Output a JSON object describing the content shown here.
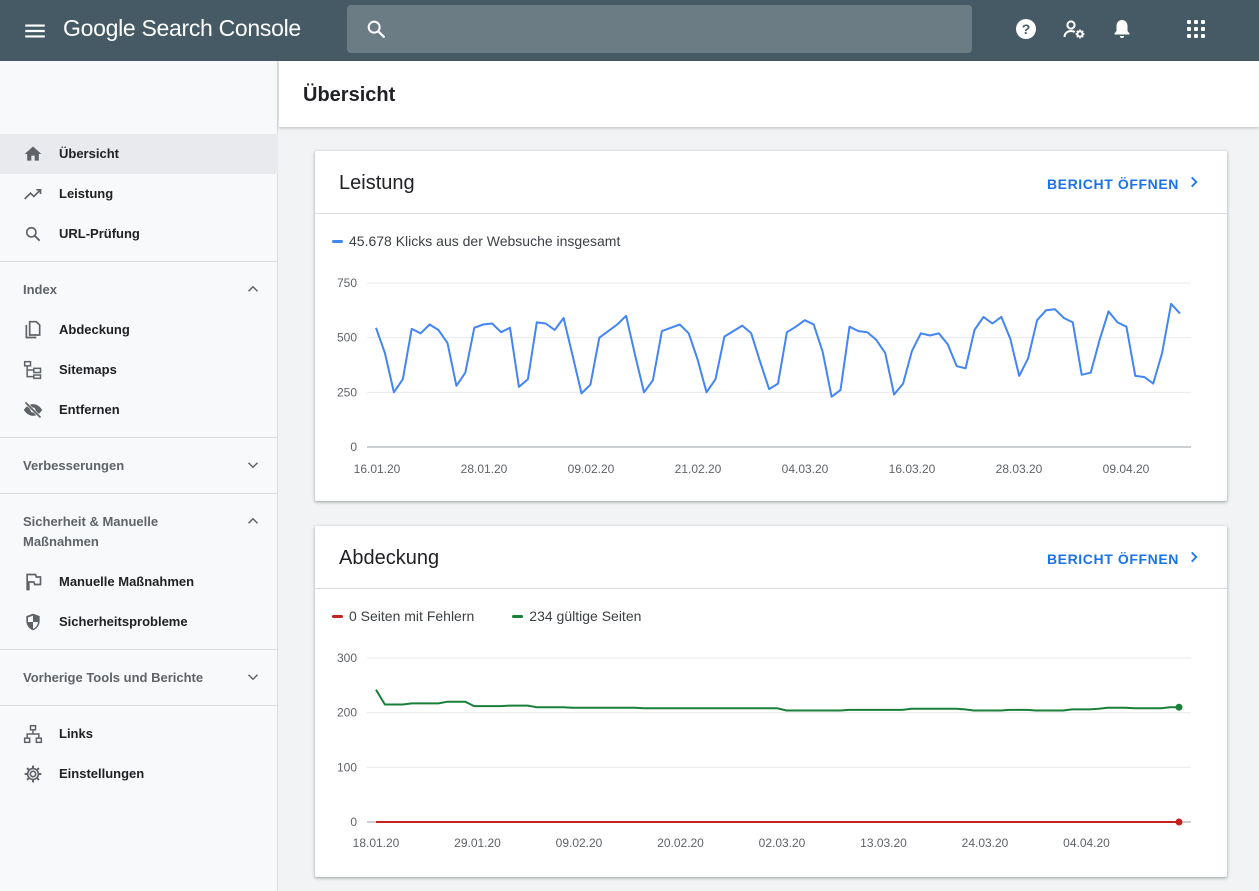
{
  "app": {
    "title": "Google Search Console"
  },
  "search": {
    "placeholder": "",
    "value": ""
  },
  "sidebar": {
    "items": [
      {
        "label": "Übersicht",
        "icon": "home-icon",
        "active": true
      },
      {
        "label": "Leistung",
        "icon": "trending-up-icon"
      },
      {
        "label": "URL-Prüfung",
        "icon": "search-icon"
      }
    ],
    "sections": [
      {
        "label": "Index",
        "expanded": true,
        "items": [
          {
            "label": "Abdeckung",
            "icon": "copy-icon"
          },
          {
            "label": "Sitemaps",
            "icon": "sitemap-icon"
          },
          {
            "label": "Entfernen",
            "icon": "visibility-off-icon"
          }
        ]
      },
      {
        "label": "Verbesserungen",
        "expanded": false,
        "items": []
      },
      {
        "label": "Sicherheit & Manuelle Maßnahmen",
        "expanded": true,
        "items": [
          {
            "label": "Manuelle Maßnahmen",
            "icon": "flag-icon"
          },
          {
            "label": "Sicherheitsprobleme",
            "icon": "shield-icon"
          }
        ]
      },
      {
        "label": "Vorherige Tools und Berichte",
        "expanded": false,
        "items": []
      }
    ],
    "footer_items": [
      {
        "label": "Links",
        "icon": "links-icon"
      },
      {
        "label": "Einstellungen",
        "icon": "settings-icon"
      }
    ]
  },
  "page": {
    "title": "Übersicht"
  },
  "cards": {
    "performance": {
      "title": "Leistung",
      "link": "BERICHT ÖFFNEN"
    },
    "coverage": {
      "title": "Abdeckung",
      "link": "BERICHT ÖFFNEN"
    }
  },
  "colors": {
    "blue": "#4285f4",
    "red": "#c5221f",
    "green": "#188038",
    "topbar": "#455a64"
  },
  "chart_data": [
    {
      "type": "line",
      "title": "",
      "series": [
        {
          "name": "45.678 Klicks aus der Websuche insgesamt",
          "color": "#4285f4",
          "values": [
            545,
            430,
            250,
            310,
            540,
            520,
            560,
            535,
            475,
            280,
            340,
            545,
            560,
            565,
            525,
            545,
            275,
            310,
            570,
            565,
            535,
            590,
            420,
            245,
            285,
            500,
            530,
            560,
            600,
            420,
            250,
            305,
            530,
            545,
            560,
            520,
            400,
            250,
            310,
            505,
            530,
            555,
            520,
            390,
            265,
            290,
            525,
            550,
            580,
            560,
            435,
            230,
            260,
            550,
            530,
            525,
            490,
            430,
            240,
            290,
            440,
            520,
            510,
            520,
            470,
            370,
            360,
            535,
            595,
            565,
            595,
            495,
            325,
            405,
            580,
            625,
            630,
            590,
            570,
            330,
            340,
            490,
            620,
            570,
            550,
            325,
            320,
            290,
            430,
            655,
            610
          ]
        }
      ],
      "x": {
        "tick_labels": [
          "16.01.20",
          "28.01.20",
          "09.02.20",
          "21.02.20",
          "04.03.20",
          "16.03.20",
          "28.03.20",
          "09.04.20"
        ]
      },
      "y": {
        "tick_labels": [
          "750",
          "500",
          "250",
          "0"
        ]
      },
      "ylim": [
        0,
        750
      ],
      "grid": true
    },
    {
      "type": "line",
      "title": "",
      "series": [
        {
          "name": "0 Seiten mit Fehlern",
          "color": "#c5221f",
          "values": [
            0,
            0,
            0,
            0,
            0,
            0,
            0,
            0,
            0,
            0,
            0,
            0,
            0,
            0,
            0,
            0,
            0,
            0,
            0,
            0,
            0,
            0,
            0,
            0,
            0,
            0,
            0,
            0,
            0,
            0,
            0,
            0,
            0,
            0,
            0,
            0,
            0,
            0,
            0,
            0,
            0,
            0,
            0,
            0,
            0,
            0,
            0,
            0,
            0,
            0,
            0,
            0,
            0,
            0,
            0,
            0,
            0,
            0,
            0,
            0,
            0,
            0,
            0,
            0,
            0,
            0,
            0,
            0,
            0,
            0,
            0,
            0,
            0,
            0,
            0,
            0,
            0,
            0,
            0,
            0,
            0,
            0,
            0,
            0,
            0,
            0,
            0,
            0,
            0
          ]
        },
        {
          "name": "234 gültige Seiten",
          "color": "#188038",
          "values": [
            242,
            215,
            215,
            215,
            217,
            217,
            217,
            217,
            220,
            220,
            220,
            212,
            212,
            212,
            212,
            213,
            213,
            213,
            210,
            210,
            210,
            210,
            209,
            209,
            209,
            209,
            209,
            209,
            209,
            209,
            208,
            208,
            208,
            208,
            208,
            208,
            208,
            208,
            208,
            208,
            208,
            208,
            208,
            208,
            208,
            208,
            204,
            204,
            204,
            204,
            204,
            204,
            204,
            205,
            205,
            205,
            205,
            205,
            205,
            205,
            207,
            207,
            207,
            207,
            207,
            207,
            206,
            204,
            204,
            204,
            204,
            205,
            205,
            205,
            204,
            204,
            204,
            204,
            206,
            206,
            206,
            207,
            209,
            209,
            209,
            208,
            208,
            208,
            208,
            210,
            210
          ]
        }
      ],
      "x": {
        "tick_labels": [
          "18.01.20",
          "29.01.20",
          "09.02.20",
          "20.02.20",
          "02.03.20",
          "13.03.20",
          "24.03.20",
          "04.04.20"
        ]
      },
      "y": {
        "tick_labels": [
          "300",
          "200",
          "100",
          "0"
        ]
      },
      "ylim": [
        0,
        300
      ],
      "grid": true
    }
  ]
}
